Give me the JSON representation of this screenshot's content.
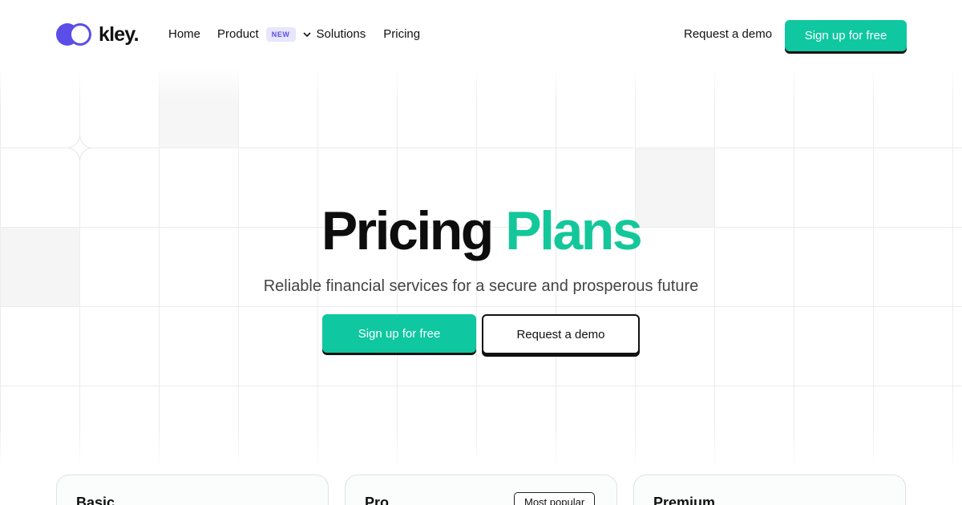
{
  "brand": {
    "name": "kley.",
    "logo_color": "#5b4ee8"
  },
  "nav": {
    "items": [
      {
        "label": "Home"
      },
      {
        "label": "Product",
        "badge": "NEW",
        "has_dropdown": true
      },
      {
        "label": "Solutions"
      },
      {
        "label": "Pricing"
      }
    ]
  },
  "header_actions": {
    "request_demo": "Request a demo",
    "signup": "Sign up for free"
  },
  "hero": {
    "title_part1": "Pricing",
    "title_part2": "Plans",
    "subtitle": "Reliable financial services for a secure and prosperous future",
    "primary_cta": "Sign up for free",
    "secondary_cta": "Request a demo"
  },
  "plans": [
    {
      "name": "Basic"
    },
    {
      "name": "Pro",
      "tag": "Most popular"
    },
    {
      "name": "Premium"
    }
  ],
  "colors": {
    "accent": "#0fc7a0",
    "title_accent": "#14c79a",
    "brand": "#5b4ee8",
    "text": "#111111"
  },
  "icons": {
    "dropdown": "chevron-down-icon",
    "logo": "kley-logo-icon"
  }
}
